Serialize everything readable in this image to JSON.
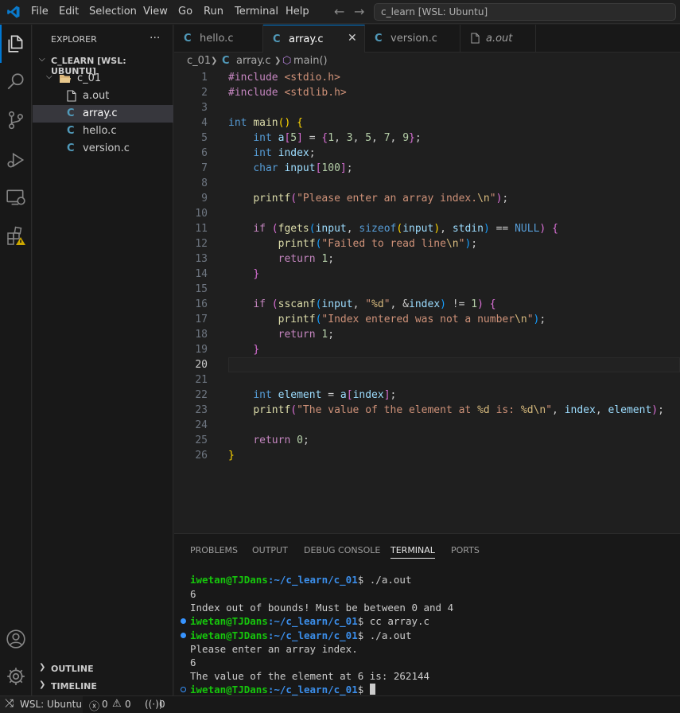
{
  "menu": [
    "File",
    "Edit",
    "Selection",
    "View",
    "Go",
    "Run",
    "Terminal",
    "Help"
  ],
  "search": {
    "text": "c_learn [WSL: Ubuntu]"
  },
  "explorer": {
    "title": "EXPLORER",
    "more": "···",
    "workspace": "C_LEARN [WSL: UBUNTU]",
    "folder": "c_01",
    "files": [
      "a.out",
      "array.c",
      "hello.c",
      "version.c"
    ],
    "outline": "OUTLINE",
    "timeline": "TIMELINE"
  },
  "tabs": [
    "hello.c",
    "array.c",
    "version.c",
    "a.out"
  ],
  "breadcrumb": {
    "folder": "c_01",
    "file": "array.c",
    "symbol": "main()"
  },
  "code_lines": [
    "1",
    "2",
    "3",
    "4",
    "5",
    "6",
    "7",
    "8",
    "9",
    "10",
    "11",
    "12",
    "13",
    "14",
    "15",
    "16",
    "17",
    "18",
    "19",
    "20",
    "21",
    "22",
    "23",
    "24",
    "25",
    "26"
  ],
  "panel_tabs": [
    "PROBLEMS",
    "OUTPUT",
    "DEBUG CONSOLE",
    "TERMINAL",
    "PORTS"
  ],
  "terminal": {
    "user": "iwetan@TJDans",
    "path": ":~/c_learn/c_01",
    "lines": {
      "cmd1": "$ ./a.out",
      "out1": "6",
      "out2": "Index out of bounds! Must be between 0 and 4",
      "cmd2": "$ cc array.c",
      "cmd3": "$ ./a.out",
      "out3": "Please enter an array index.",
      "out4": "6",
      "out5": "The value of the element at 6 is: 262144",
      "cmd4": "$ "
    }
  },
  "status": {
    "remote": "WSL: Ubuntu",
    "errors": "0",
    "warnings": "0",
    "ports": "0"
  },
  "colors": {
    "accent": "#0078d4",
    "c_icon": "#519aba",
    "term_user": "#16c60c",
    "term_path": "#3b8eea"
  }
}
